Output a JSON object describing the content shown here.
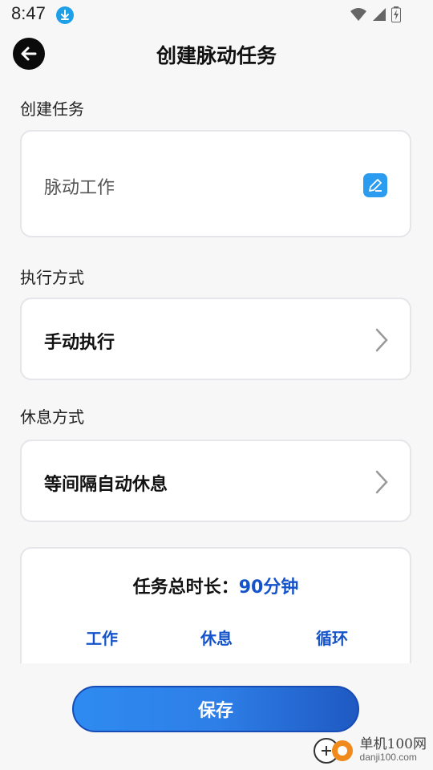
{
  "status_bar": {
    "time": "8:47"
  },
  "header": {
    "title": "创建脉动任务"
  },
  "task_section": {
    "label": "创建任务",
    "task_name": "脉动工作"
  },
  "execution_section": {
    "label": "执行方式",
    "value": "手动执行"
  },
  "rest_section": {
    "label": "休息方式",
    "value": "等间隔自动休息"
  },
  "summary": {
    "duration_label": "任务总时长：",
    "duration_value": "90分钟",
    "tabs": [
      "工作",
      "休息",
      "循环"
    ]
  },
  "save_button": {
    "label": "保存"
  },
  "watermark": {
    "name": "单机100网",
    "url": "danji100.com"
  },
  "colors": {
    "accent": "#1453c9",
    "button": "#2e7fe8",
    "edit_icon": "#2c9cf0"
  }
}
